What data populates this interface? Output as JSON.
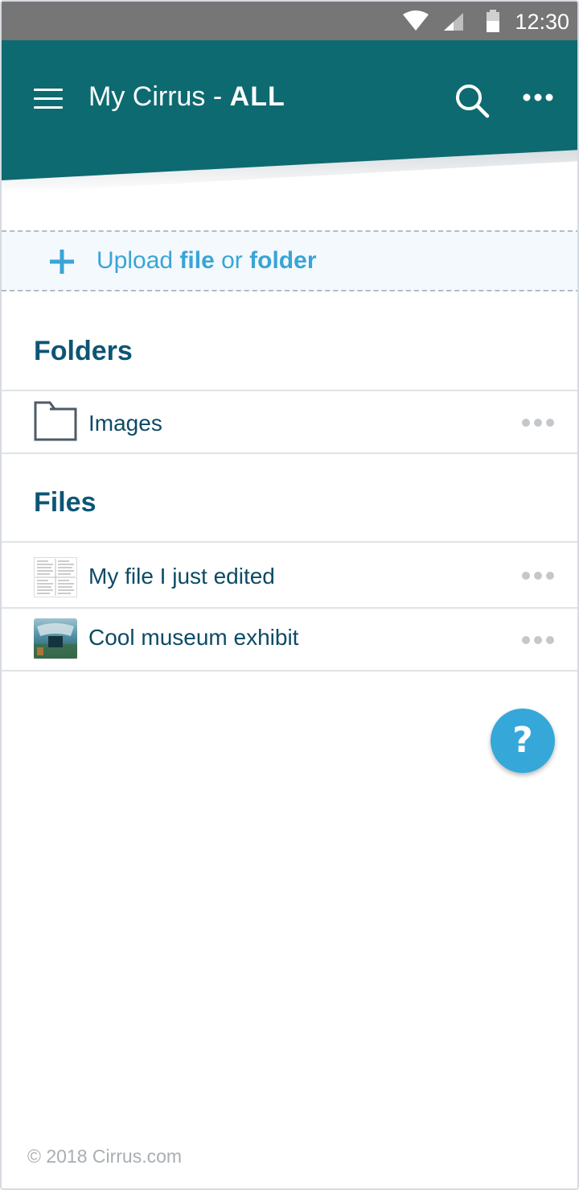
{
  "status_bar": {
    "time": "12:30",
    "icons": [
      "wifi-icon",
      "signal-icon",
      "battery-icon"
    ]
  },
  "app_bar": {
    "title_prefix": "My Cirrus - ",
    "title_scope": "ALL",
    "icons": [
      "menu-icon",
      "search-icon",
      "more-icon"
    ],
    "color": "#0d6a70"
  },
  "upload": {
    "word_upload": "Upload",
    "word_file": "file",
    "word_or": "or",
    "word_folder": "folder",
    "color": "#38a5d6"
  },
  "folders": {
    "heading": "Folders",
    "items": [
      {
        "name": "Images",
        "icon": "folder-icon"
      }
    ]
  },
  "files": {
    "heading": "Files",
    "items": [
      {
        "name": "My file I just edited",
        "icon": "document-thumbnail"
      },
      {
        "name": "Cool museum exhibit",
        "icon": "image-thumbnail"
      }
    ]
  },
  "help_button": {
    "label": "?"
  },
  "footer": {
    "text": "© 2018 Cirrus.com"
  }
}
